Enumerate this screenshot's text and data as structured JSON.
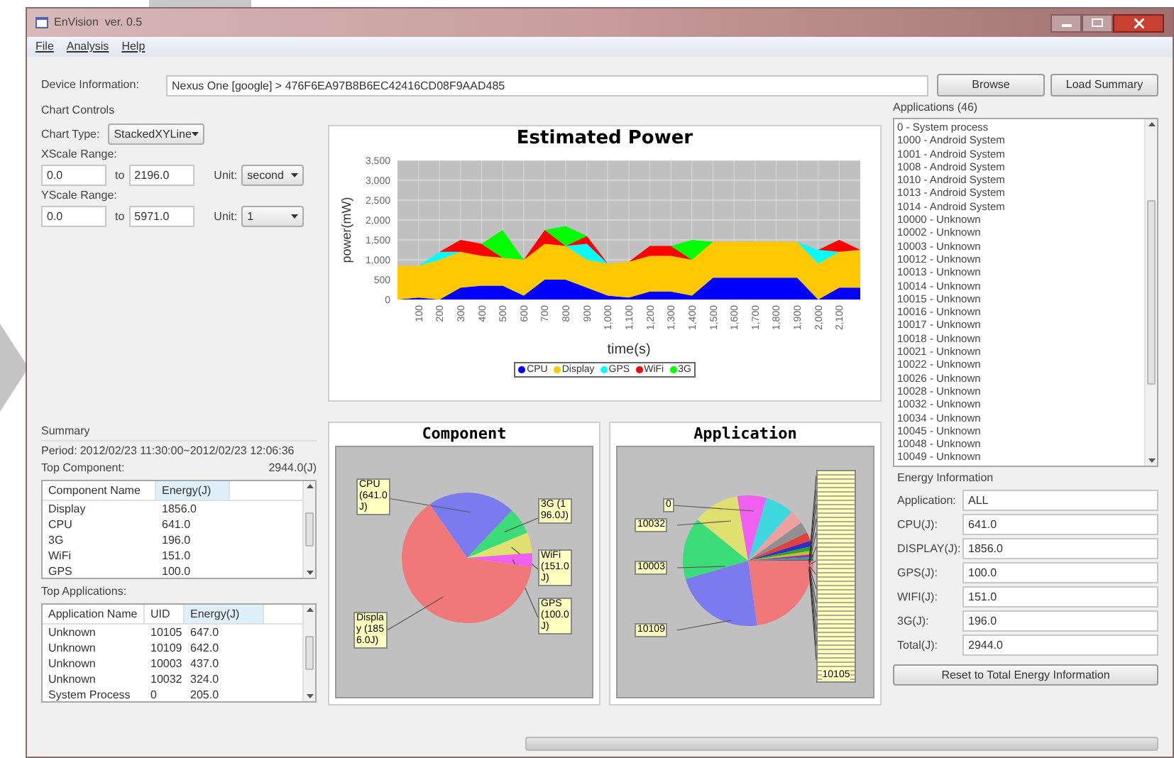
{
  "window": {
    "title": "EnVision  ver. 0.5"
  },
  "menu": [
    "File",
    "Analysis",
    "Help"
  ],
  "device": {
    "label": "Device Information:",
    "value": "Nexus One [google] > 476F6EA97B8B6EC42416CD08F9AAD485",
    "buttons": [
      "Browse",
      "Load Summary"
    ]
  },
  "chart_controls": {
    "title": "Chart Controls",
    "chart_type_label": "Chart Type:",
    "chart_type": "StackedXYLine",
    "ranges": [
      {
        "label": "XScale Range:",
        "from": "0.0",
        "to_label": "to",
        "to": "2196.0",
        "unit_label": "Unit:",
        "unit": "second"
      },
      {
        "label": "YScale Range:",
        "from": "0.0",
        "to_label": "to",
        "to": "5971.0",
        "unit_label": "Unit:",
        "unit": "1"
      }
    ]
  },
  "power_chart": {
    "chart_data": {
      "type": "area",
      "stacked": true,
      "grid": true,
      "legend": true,
      "title": "Estimated Power",
      "xlabel": "time(s)",
      "ylabel": "power(mW)",
      "xlim": [
        0,
        2200
      ],
      "ylim": [
        0,
        3500
      ],
      "yticks": [
        {
          "value": 0,
          "label": "0"
        },
        {
          "value": 500,
          "label": "500"
        },
        {
          "value": 1000,
          "label": "1,000"
        },
        {
          "value": 1500,
          "label": "1,500"
        },
        {
          "value": 2000,
          "label": "2,000"
        },
        {
          "value": 2500,
          "label": "2,500"
        },
        {
          "value": 3000,
          "label": "3,000"
        },
        {
          "value": 3500,
          "label": "3,500"
        }
      ],
      "xticks": [
        {
          "value": 100,
          "label": "100"
        },
        {
          "value": 200,
          "label": "200"
        },
        {
          "value": 300,
          "label": "300"
        },
        {
          "value": 400,
          "label": "400"
        },
        {
          "value": 500,
          "label": "500"
        },
        {
          "value": 600,
          "label": "600"
        },
        {
          "value": 700,
          "label": "700"
        },
        {
          "value": 800,
          "label": "800"
        },
        {
          "value": 900,
          "label": "900"
        },
        {
          "value": 1000,
          "label": "1,000"
        },
        {
          "value": 1100,
          "label": "1,100"
        },
        {
          "value": 1200,
          "label": "1,200"
        },
        {
          "value": 1300,
          "label": "1,300"
        },
        {
          "value": 1400,
          "label": "1,400"
        },
        {
          "value": 1500,
          "label": "1,500"
        },
        {
          "value": 1600,
          "label": "1,600"
        },
        {
          "value": 1700,
          "label": "1,700"
        },
        {
          "value": 1800,
          "label": "1,800"
        },
        {
          "value": 1900,
          "label": "1,900"
        },
        {
          "value": 2000,
          "label": "2,000"
        },
        {
          "value": 2100,
          "label": "2,100"
        }
      ],
      "x": [
        0,
        100,
        200,
        300,
        400,
        500,
        600,
        700,
        800,
        900,
        1000,
        1100,
        1200,
        1300,
        1400,
        1500,
        1600,
        1700,
        1800,
        1900,
        2000,
        2100,
        2200
      ],
      "series": [
        {
          "name": "CPU",
          "color": "#0000ff",
          "values": [
            0,
            50,
            0,
            300,
            350,
            350,
            100,
            500,
            500,
            300,
            100,
            50,
            200,
            200,
            100,
            550,
            550,
            550,
            550,
            550,
            0,
            300,
            300
          ]
        },
        {
          "name": "Display",
          "color": "#ffc800",
          "values": [
            850,
            800,
            1000,
            900,
            750,
            700,
            900,
            900,
            850,
            700,
            800,
            900,
            900,
            900,
            900,
            900,
            900,
            900,
            900,
            900,
            900,
            900,
            950
          ]
        },
        {
          "name": "GPS",
          "color": "#00ffff",
          "values": [
            0,
            0,
            200,
            0,
            0,
            0,
            0,
            0,
            0,
            400,
            0,
            0,
            0,
            0,
            0,
            0,
            0,
            0,
            0,
            0,
            350,
            0,
            0
          ]
        },
        {
          "name": "WiFi",
          "color": "#ff0000",
          "values": [
            0,
            0,
            0,
            300,
            300,
            0,
            0,
            350,
            0,
            200,
            0,
            0,
            250,
            250,
            0,
            0,
            0,
            0,
            0,
            0,
            0,
            300,
            0
          ]
        },
        {
          "name": "3G",
          "color": "#00ff00",
          "values": [
            0,
            0,
            0,
            0,
            0,
            700,
            0,
            0,
            500,
            0,
            0,
            0,
            0,
            0,
            500,
            0,
            0,
            0,
            0,
            0,
            0,
            0,
            0
          ]
        }
      ]
    }
  },
  "component_chart": {
    "chart_data": {
      "type": "pie",
      "title": "Component",
      "categories": [
        "CPU",
        "3G",
        "WiFi",
        "GPS",
        "Display"
      ],
      "values": [
        641,
        196,
        151,
        100,
        1856
      ],
      "value_labels": [
        "(641.0J)",
        "(196.0J)",
        "(151.0J)",
        "(100.0J)",
        "(1856.0J)"
      ]
    }
  },
  "application_chart": {
    "title": "Application",
    "labels": [
      "0",
      "10032",
      "10003",
      "10109",
      "10105"
    ]
  },
  "summary": {
    "title": "Summary",
    "period_label": "Period:",
    "period": "2012/02/23 11:30:00~2012/02/23 12:06:36",
    "top_component_label": "Top Component:",
    "total": "2944.0(J)",
    "component_table": {
      "columns": [
        "Component Name",
        "Energy(J)"
      ],
      "rows": [
        [
          "Display",
          "1856.0"
        ],
        [
          "CPU",
          "641.0"
        ],
        [
          "3G",
          "196.0"
        ],
        [
          "WiFi",
          "151.0"
        ],
        [
          "GPS",
          "100.0"
        ]
      ]
    },
    "top_applications_label": "Top Applications:",
    "app_table": {
      "columns": [
        "Application Name",
        "UID",
        "Energy(J)"
      ],
      "rows": [
        [
          "Unknown",
          "10105",
          "647.0"
        ],
        [
          "Unknown",
          "10109",
          "642.0"
        ],
        [
          "Unknown",
          "10003",
          "437.0"
        ],
        [
          "Unknown",
          "10032",
          "324.0"
        ],
        [
          "System Process",
          "0",
          "205.0"
        ]
      ]
    }
  },
  "applications": {
    "title": "Applications (46)",
    "items": [
      "0 - System process",
      "1000 - Android System",
      "1001 - Android System",
      "1008 - Android System",
      "1010 - Android System",
      "1013 - Android System",
      "1014 - Android System",
      "10000 - Unknown",
      "10002 - Unknown",
      "10003 - Unknown",
      "10012 - Unknown",
      "10013 - Unknown",
      "10014 - Unknown",
      "10015 - Unknown",
      "10016 - Unknown",
      "10017 - Unknown",
      "10018 - Unknown",
      "10021 - Unknown",
      "10022 - Unknown",
      "10026 - Unknown",
      "10028 - Unknown",
      "10032 - Unknown",
      "10034 - Unknown",
      "10045 - Unknown",
      "10048 - Unknown",
      "10049 - Unknown"
    ]
  },
  "status_bar": {
    "progress": {
      "level": 0
    }
  },
  "energy_info": {
    "title": "Energy Information",
    "fields": [
      {
        "label": "Application:",
        "value": "ALL"
      },
      {
        "label": "CPU(J):",
        "value": "641.0"
      },
      {
        "label": "DISPLAY(J):",
        "value": "1856.0"
      },
      {
        "label": "GPS(J):",
        "value": "100.0"
      },
      {
        "label": "WIFI(J):",
        "value": "151.0"
      },
      {
        "label": "3G(J):",
        "value": "196.0"
      },
      {
        "label": "Total(J):",
        "value": "2944.0"
      }
    ],
    "reset_button": "Reset to Total Energy Information"
  }
}
